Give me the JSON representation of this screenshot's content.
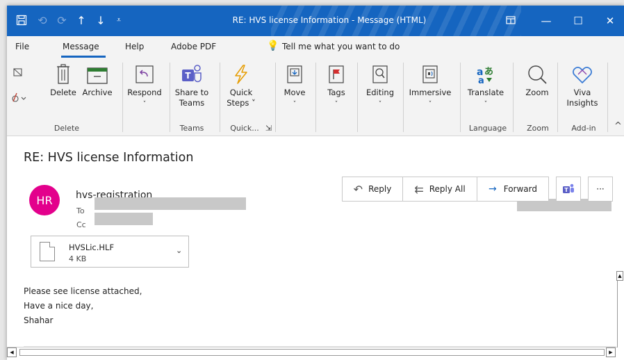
{
  "window": {
    "title": "RE: HVS license Information  -  Message (HTML)",
    "controls": {
      "minimize": "—",
      "maximize": "☐",
      "close": "✕"
    }
  },
  "menu": [
    "File",
    "Message",
    "Help",
    "Adobe PDF"
  ],
  "tell_me": "Tell me what you want to do",
  "ribbon": {
    "delete": "Delete",
    "archive": "Archive",
    "respond": "Respond",
    "share_to_teams": [
      "Share to",
      "Teams"
    ],
    "quick_steps": [
      "Quick",
      "Steps ˅"
    ],
    "move": "Move",
    "tags": "Tags",
    "editing": "Editing",
    "immersive": "Immersive",
    "translate": "Translate",
    "zoom": "Zoom",
    "viva_insights": [
      "Viva",
      "Insights"
    ],
    "groups": {
      "delete": "Delete",
      "teams": "Teams",
      "quick": "Quick...",
      "language": "Language",
      "zoom": "Zoom",
      "addin": "Add-in"
    }
  },
  "message": {
    "subject": "RE: HVS license Information",
    "avatar_initials": "HR",
    "sender": "hvs-registration",
    "to_label": "To",
    "cc_label": "Cc",
    "actions": {
      "reply": "Reply",
      "reply_all": "Reply All",
      "forward": "Forward",
      "more": "···"
    },
    "attachment": {
      "name": "HVSLic.HLF",
      "size": "4 KB"
    },
    "body": [
      "Please see license attached,",
      "Have a nice day,",
      "Shahar"
    ]
  },
  "colors": {
    "titlebar": "#1565c0",
    "avatar": "#e3008c",
    "accent": "#1565c0"
  }
}
